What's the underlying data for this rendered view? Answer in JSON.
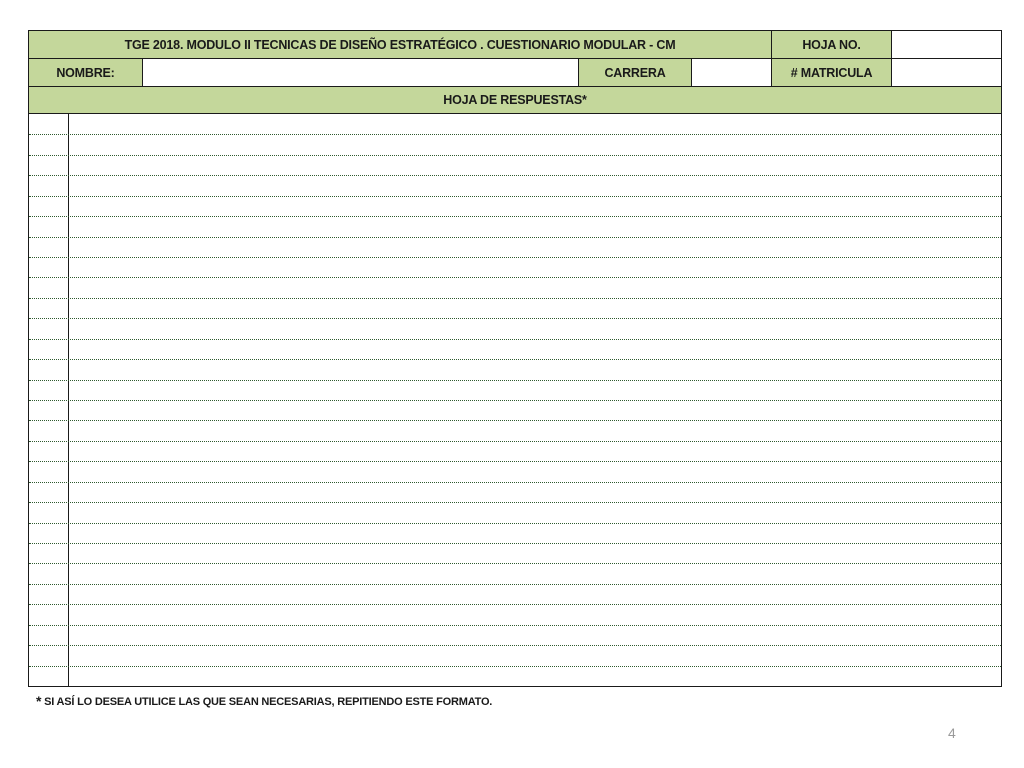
{
  "header": {
    "title": "TGE 2018.  MODULO II  TECNICAS DE DISEÑO ESTRATÉGICO . CUESTIONARIO MODULAR - CM",
    "sheet_label": "HOJA NO.",
    "sheet_value": ""
  },
  "student": {
    "name_label": "NOMBRE:",
    "name_value": "",
    "career_label": "CARRERA",
    "career_value": "",
    "id_label": "# MATRICULA",
    "id_value": ""
  },
  "answers": {
    "section_title": "HOJA DE RESPUESTAS*",
    "line_count": 28
  },
  "footnote": {
    "star": "*",
    "text": " SI ASÍ LO DESEA UTILICE  LAS QUE SEAN NECESARIAS, REPITIENDO ESTE FORMATO."
  },
  "page_number": "4",
  "colors": {
    "header_fill": "#c4d79b",
    "border": "#1a1a1a",
    "rule_line": "#2f5a2f"
  }
}
